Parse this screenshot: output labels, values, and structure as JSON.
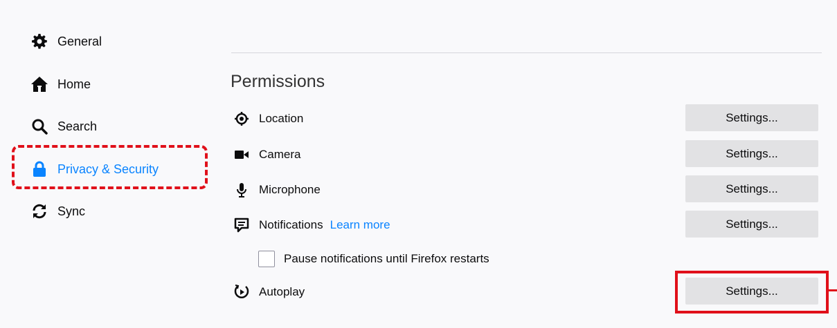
{
  "sidebar": {
    "items": [
      {
        "label": "General",
        "icon": "gear-icon"
      },
      {
        "label": "Home",
        "icon": "home-icon"
      },
      {
        "label": "Search",
        "icon": "search-icon"
      },
      {
        "label": "Privacy & Security",
        "icon": "lock-icon",
        "selected": true
      },
      {
        "label": "Sync",
        "icon": "sync-icon"
      }
    ]
  },
  "permissions": {
    "title": "Permissions",
    "rows": [
      {
        "label": "Location",
        "icon": "location-icon",
        "button": "Settings..."
      },
      {
        "label": "Camera",
        "icon": "camera-icon",
        "button": "Settings..."
      },
      {
        "label": "Microphone",
        "icon": "microphone-icon",
        "button": "Settings..."
      },
      {
        "label": "Notifications",
        "icon": "notification-icon",
        "button": "Settings...",
        "link": "Learn more"
      },
      {
        "label": "Autoplay",
        "icon": "autoplay-icon",
        "button": "Settings..."
      }
    ],
    "pause_checkbox": {
      "label": "Pause notifications until Firefox restarts",
      "checked": false
    }
  },
  "colors": {
    "accent": "#0a84ff",
    "highlight": "#e0101a",
    "button_bg": "#e2e2e4",
    "background": "#f9f9fb"
  }
}
